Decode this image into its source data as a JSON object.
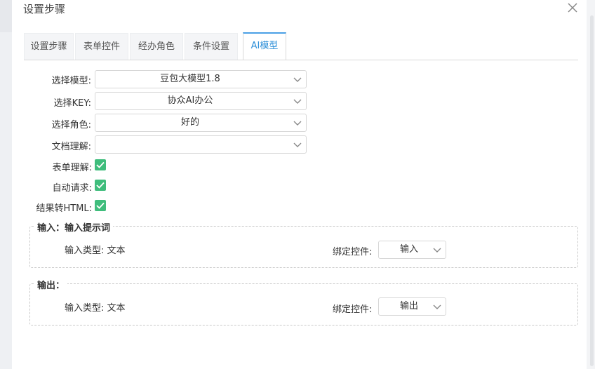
{
  "dialog": {
    "title": "设置步骤"
  },
  "tabs": [
    {
      "label": "设置步骤",
      "active": false
    },
    {
      "label": "表单控件",
      "active": false
    },
    {
      "label": "经办角色",
      "active": false
    },
    {
      "label": "条件设置",
      "active": false
    },
    {
      "label": "AI模型",
      "active": true
    }
  ],
  "form": {
    "model": {
      "label": "选择模型:",
      "value": "豆包大模型1.8"
    },
    "key": {
      "label": "选择KEY:",
      "value": "协众AI办公"
    },
    "role": {
      "label": "选择角色:",
      "value": "好的"
    },
    "doc": {
      "label": "文档理解:",
      "value": ""
    },
    "form_understanding": {
      "label": "表单理解:",
      "checked": true
    },
    "auto_request": {
      "label": "自动请求:",
      "checked": true
    },
    "to_html": {
      "label": "结果转HTML:",
      "checked": true
    }
  },
  "input_section": {
    "legend": "输入：输入提示词",
    "type_text": "输入类型: 文本",
    "bind_label": "绑定控件:",
    "bind_value": "输入"
  },
  "output_section": {
    "legend": "输出：",
    "type_text": "输入类型: 文本",
    "bind_label": "绑定控件:",
    "bind_value": "输出"
  },
  "colors": {
    "accent": "#2d8fd8",
    "checkbox": "#3fbd7c"
  }
}
